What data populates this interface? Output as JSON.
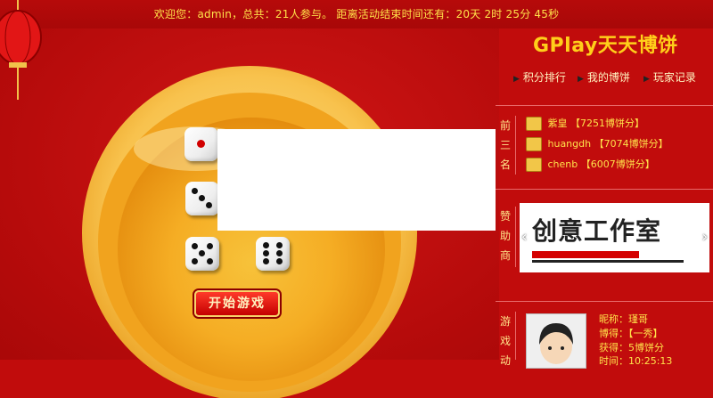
{
  "status_bar": {
    "text": "欢迎您：admin，总共：21人参与。 距离活动结束时间还有：20天 2时 25分 45秒"
  },
  "brand": {
    "title": "GPlay天天博饼"
  },
  "nav": {
    "items": [
      {
        "label": "积分排行",
        "icon": "arrow-right-icon"
      },
      {
        "label": "我的博饼",
        "icon": "arrow-right-icon"
      },
      {
        "label": "玩家记录",
        "icon": "arrow-right-icon"
      }
    ]
  },
  "top_three": {
    "label": "前三名",
    "entries": [
      {
        "name": "紫皇",
        "score": "【7251博饼分】"
      },
      {
        "name": "huangdh",
        "score": "【7074博饼分】"
      },
      {
        "name": "chenb",
        "score": "【6007博饼分】"
      }
    ]
  },
  "sponsor": {
    "label": "赞助商",
    "logo_text": "创意工作室"
  },
  "activity": {
    "label": "游戏动",
    "nickname_line": "昵称：瑾哥",
    "got_line": "博得：【一秀】",
    "earn_line": "获得：5博饼分",
    "time_line": "时间：10:25:13"
  },
  "game": {
    "start_button": "开始游戏",
    "dice_values": [
      1,
      3,
      5,
      6
    ]
  },
  "colors": {
    "background": "#c10c0c",
    "highlight": "#ffe24a",
    "brand": "#ffcf1a",
    "bowl_rim": "#f6b323"
  }
}
